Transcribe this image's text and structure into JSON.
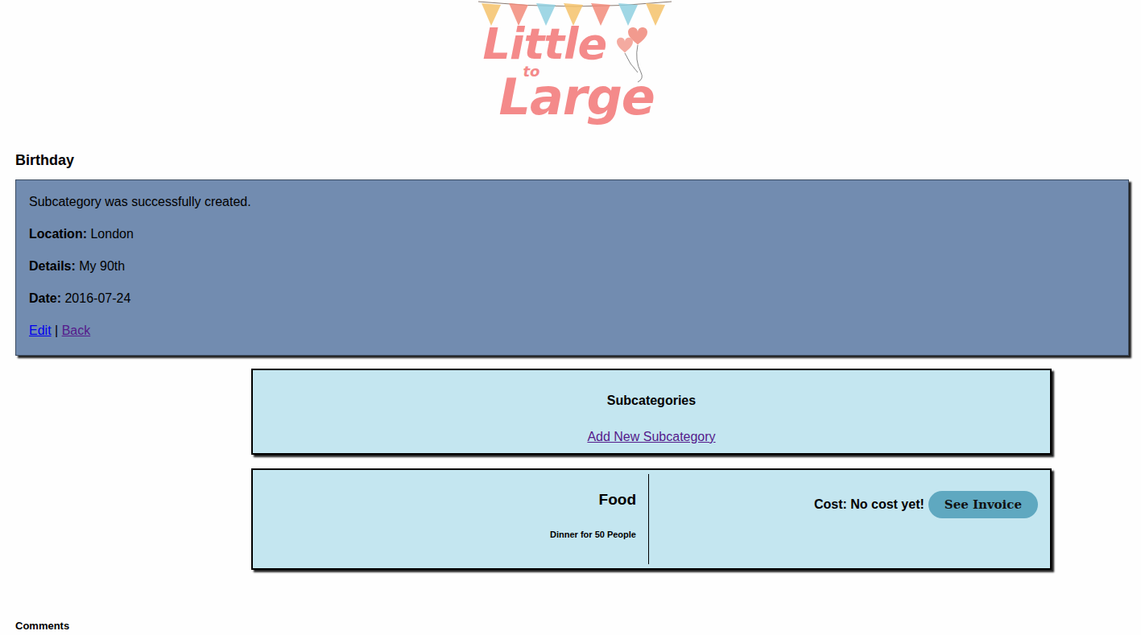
{
  "logo": {
    "line1": "Little",
    "line2": "to",
    "line3": "Large"
  },
  "heading": "Birthday",
  "notice": "Subcategory was successfully created.",
  "fields": [
    {
      "label": "Location:",
      "value": "London"
    },
    {
      "label": "Details:",
      "value": "My 90th"
    },
    {
      "label": "Date:",
      "value": "2016-07-24"
    }
  ],
  "links": [
    {
      "label": "Edit",
      "visited": false
    },
    {
      "label": "Back",
      "visited": true
    }
  ],
  "link_separator": "|",
  "subcategories": {
    "title": "Subcategories",
    "add_link": {
      "label": "Add New Subcategory",
      "visited": true
    },
    "items": [
      {
        "name": "Food",
        "description": "Dinner for 50 People",
        "cost": "Cost: No cost yet!",
        "button": "See Invoice"
      }
    ]
  },
  "comments": "Comments"
}
